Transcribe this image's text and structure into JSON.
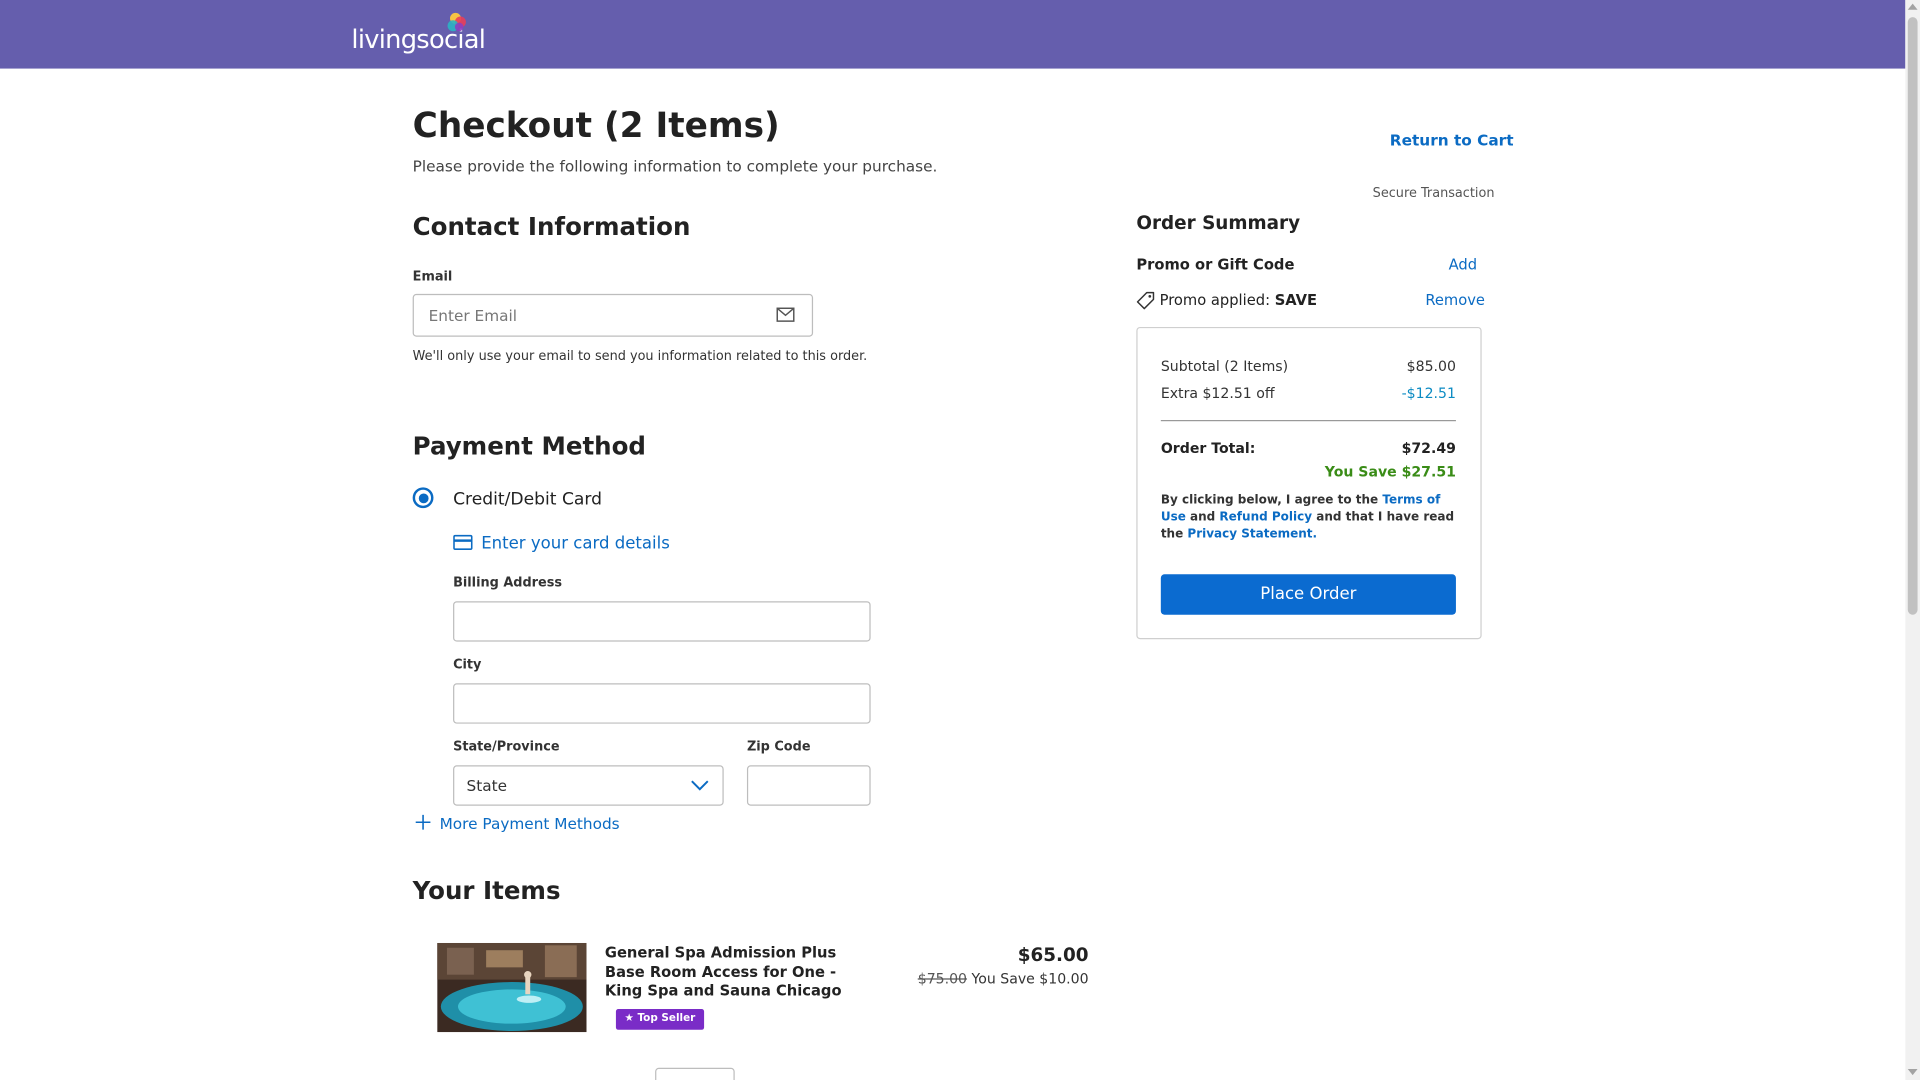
{
  "brand": {
    "logo_text": "livingsocial",
    "colors": {
      "header": "#655ead",
      "accent": "#0b6bc3",
      "badge": "#7a2cc7",
      "savings": "#3a8c17"
    }
  },
  "header": {
    "title": "Checkout (2 Items)",
    "subtitle": "Please provide the following information to complete your purchase.",
    "return_cart": "Return to Cart",
    "secure": "Secure Transaction"
  },
  "contact": {
    "heading": "Contact Information",
    "email_label": "Email",
    "email_placeholder": "Enter Email",
    "email_value": "",
    "email_icon": "envelope-icon",
    "helper": "We'll only use your email to send you information related to this order."
  },
  "payment": {
    "heading": "Payment Method",
    "option_label": "Credit/Debit Card",
    "option_selected": true,
    "card_link": "Enter your card details",
    "card_icon": "credit-card-icon",
    "billing_label": "Billing Address",
    "billing_value": "",
    "city_label": "City",
    "city_value": "",
    "state_label": "State/Province",
    "state_value": "State",
    "zip_label": "Zip Code",
    "zip_value": "",
    "more_methods": "More Payment Methods"
  },
  "items": {
    "heading": "Your Items",
    "list": [
      {
        "title": "General Spa Admission Plus Base Room Access for One - King Spa and Sauna Chicago",
        "badge": "★ Top Seller",
        "price": "$65.00",
        "original_price": "$75.00",
        "savings": "You Save $10.00"
      }
    ]
  },
  "summary": {
    "heading": "Order Summary",
    "promo_label": "Promo or Gift Code",
    "promo_add": "Add",
    "promo_applied_prefix": "Promo applied: ",
    "promo_code": "SAVE",
    "promo_remove": "Remove",
    "subtotal_label": "Subtotal (2 Items)",
    "subtotal_value": "$85.00",
    "discount_label": "Extra $12.51 off",
    "discount_value": "-$12.51",
    "total_label": "Order Total:",
    "total_value": "$72.49",
    "you_save": "You Save $27.51",
    "legal_1": "By clicking below, I agree to the ",
    "terms": "Terms of Use",
    "legal_2": " and ",
    "refund": "Refund Policy",
    "legal_3": " and that I have read the ",
    "privacy": "Privacy Statement",
    "legal_4": ".",
    "place_order": "Place Order"
  }
}
